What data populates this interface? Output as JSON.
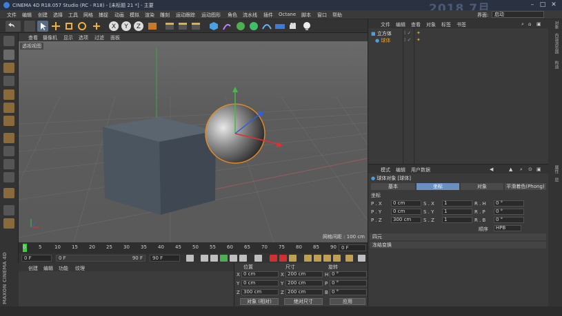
{
  "titlebar": {
    "title": "CINEMA 4D R18.057 Studio (RC - R18) - [未标题 21 *] - 主要",
    "watermark": "2018 7月"
  },
  "menu": [
    "文件",
    "编辑",
    "创建",
    "选择",
    "工具",
    "网格",
    "捕捉",
    "动画",
    "模拟",
    "渲染",
    "雕刻",
    "运动跟踪",
    "运动图形",
    "角色",
    "流水线",
    "插件",
    "Octane",
    "脚本",
    "窗口",
    "帮助"
  ],
  "layout": {
    "label": "界面:",
    "value": "启动"
  },
  "viewport": {
    "menu": [
      "查看",
      "摄像机",
      "显示",
      "选项",
      "过滤",
      "面板"
    ],
    "label": "透视视图",
    "grid_info": "网格间距 : 100 cm"
  },
  "timeline": {
    "ticks": [
      "0",
      "5",
      "10",
      "15",
      "20",
      "25",
      "30",
      "35",
      "40",
      "45",
      "50",
      "55",
      "60",
      "65",
      "70",
      "75",
      "80",
      "85",
      "90"
    ],
    "end_field": "0 F",
    "start_field": "0 F",
    "range_start": "0 F",
    "range_end": "90 F",
    "max_field": "90 F"
  },
  "material_manager": {
    "menu": [
      "创建",
      "编辑",
      "功能",
      "纹理"
    ]
  },
  "brand": "MAXON CINEMA 4D",
  "coordinates": {
    "headers": {
      "position": "位置",
      "size": "尺寸",
      "rotation": "旋转"
    },
    "rows": [
      {
        "axis": "X",
        "pos": "0 cm",
        "saxis": "X",
        "size": "200 cm",
        "raxis": "H",
        "rot": "0 °"
      },
      {
        "axis": "Y",
        "pos": "0 cm",
        "saxis": "Y",
        "size": "200 cm",
        "raxis": "P",
        "rot": "0 °"
      },
      {
        "axis": "Z",
        "pos": "300 cm",
        "saxis": "Z",
        "size": "200 cm",
        "raxis": "B",
        "rot": "0 °"
      }
    ],
    "mode_select": "对象 (相对)",
    "size_select": "绝对尺寸",
    "apply": "应用"
  },
  "object_manager": {
    "menu": [
      "文件",
      "编辑",
      "查看",
      "对象",
      "标签",
      "书签"
    ],
    "objects": [
      {
        "name": "立方体",
        "selected": false
      },
      {
        "name": "球体",
        "selected": true
      }
    ]
  },
  "attribute_manager": {
    "menu": [
      "模式",
      "编辑",
      "用户数据"
    ],
    "object_title": "球体对象 [球体]",
    "tabs": [
      "基本",
      "坐标",
      "对象",
      "平滑着色(Phong)"
    ],
    "active_tab": "坐标",
    "section": "坐标",
    "params": [
      {
        "p": "P . X",
        "pv": "0 cm",
        "s": "S . X",
        "sv": "1",
        "r": "R . H",
        "rv": "0 °"
      },
      {
        "p": "P . Y",
        "pv": "0 cm",
        "s": "S . Y",
        "sv": "1",
        "r": "R . P",
        "rv": "0 °"
      },
      {
        "p": "P . Z",
        "pv": "300 cm",
        "s": "S . Z",
        "sv": "1",
        "r": "R . B",
        "rv": "0 °"
      }
    ],
    "order_label": "顺序",
    "order_value": "HPB",
    "sections": [
      "四元",
      "冻结变换"
    ]
  },
  "right_strip": [
    "对象",
    "内容浏览器",
    "构造",
    "属性",
    "层"
  ],
  "colors": {
    "accent": "#5b9bd5",
    "selected_obj": "#f0a020",
    "active_tab": "#6a8fc0",
    "sphere_outline": "#e08a20"
  }
}
